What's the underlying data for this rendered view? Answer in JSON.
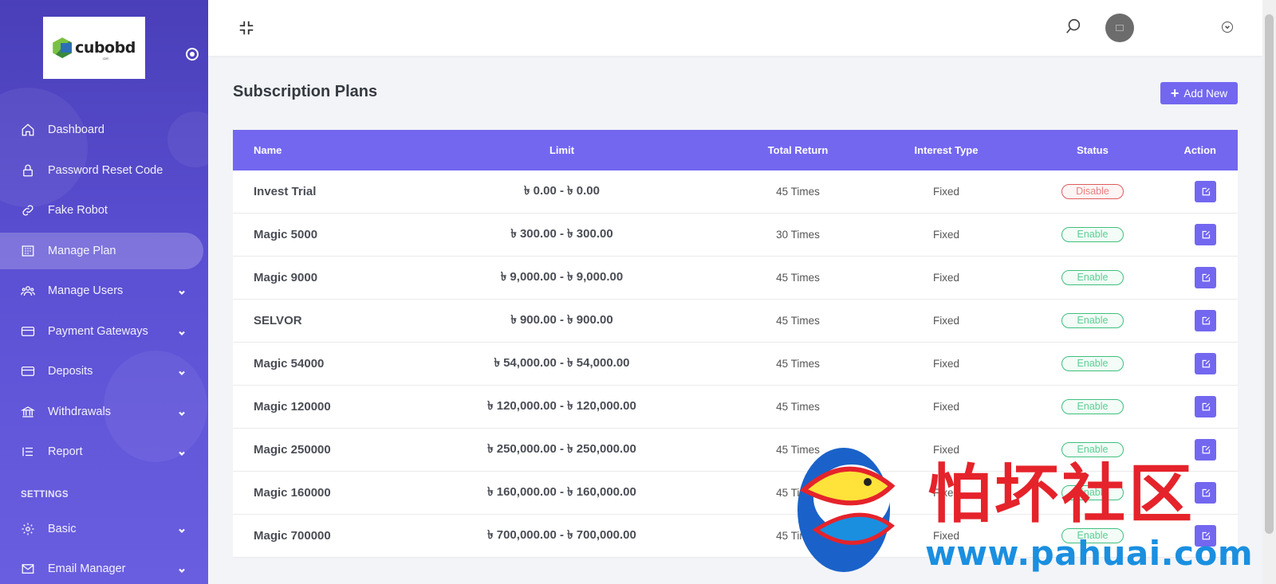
{
  "brand": {
    "name": "cubobd",
    "tld": ".com"
  },
  "sidebar": {
    "items": [
      {
        "label": "Dashboard",
        "icon": "home-icon",
        "has_submenu": false
      },
      {
        "label": "Password Reset Code",
        "icon": "lock-icon",
        "has_submenu": false
      },
      {
        "label": "Fake Robot",
        "icon": "link-icon",
        "has_submenu": false
      },
      {
        "label": "Manage Plan",
        "icon": "building-icon",
        "has_submenu": false,
        "active": true
      },
      {
        "label": "Manage Users",
        "icon": "users-icon",
        "has_submenu": true
      },
      {
        "label": "Payment Gateways",
        "icon": "credit-card-icon",
        "has_submenu": true
      },
      {
        "label": "Deposits",
        "icon": "credit-card-icon",
        "has_submenu": true
      },
      {
        "label": "Withdrawals",
        "icon": "bank-icon",
        "has_submenu": true
      },
      {
        "label": "Report",
        "icon": "list-icon",
        "has_submenu": true
      }
    ],
    "settings_heading": "SETTINGS",
    "settings_items": [
      {
        "label": "Basic",
        "icon": "gear-icon",
        "has_submenu": true
      },
      {
        "label": "Email Manager",
        "icon": "envelope-icon",
        "has_submenu": true
      }
    ]
  },
  "page": {
    "title": "Subscription Plans",
    "add_button_label": "Add New"
  },
  "table": {
    "headers": [
      "Name",
      "Limit",
      "Total Return",
      "Interest Type",
      "Status",
      "Action"
    ],
    "rows": [
      {
        "name": "Invest Trial",
        "limit": "৳ 0.00 - ৳ 0.00",
        "total_return": "45 Times",
        "interest_type": "Fixed",
        "status": "Disable"
      },
      {
        "name": "Magic 5000",
        "limit": "৳ 300.00 - ৳ 300.00",
        "total_return": "30 Times",
        "interest_type": "Fixed",
        "status": "Enable"
      },
      {
        "name": "Magic 9000",
        "limit": "৳ 9,000.00 - ৳ 9,000.00",
        "total_return": "45 Times",
        "interest_type": "Fixed",
        "status": "Enable"
      },
      {
        "name": "SELVOR",
        "limit": "৳ 900.00 - ৳ 900.00",
        "total_return": "45 Times",
        "interest_type": "Fixed",
        "status": "Enable"
      },
      {
        "name": "Magic 54000",
        "limit": "৳ 54,000.00 - ৳ 54,000.00",
        "total_return": "45 Times",
        "interest_type": "Fixed",
        "status": "Enable"
      },
      {
        "name": "Magic 120000",
        "limit": "৳ 120,000.00 - ৳ 120,000.00",
        "total_return": "45 Times",
        "interest_type": "Fixed",
        "status": "Enable"
      },
      {
        "name": "Magic 250000",
        "limit": "৳ 250,000.00 - ৳ 250,000.00",
        "total_return": "45 Times",
        "interest_type": "Fixed",
        "status": "Enable"
      },
      {
        "name": "Magic 160000",
        "limit": "৳ 160,000.00 - ৳ 160,000.00",
        "total_return": "45 Times",
        "interest_type": "Fixed",
        "status": "Enable"
      },
      {
        "name": "Magic 700000",
        "limit": "৳ 700,000.00 - ৳ 700,000.00",
        "total_return": "45 Times",
        "interest_type": "Fixed",
        "status": "Enable"
      }
    ]
  },
  "watermark": {
    "text": "怕坏社区",
    "url": "www.pahuai.com"
  },
  "colors": {
    "accent": "#7367f0",
    "sidebar": "#5b4fd3",
    "enable": "#3fbf7f",
    "disable": "#e05a5a"
  }
}
